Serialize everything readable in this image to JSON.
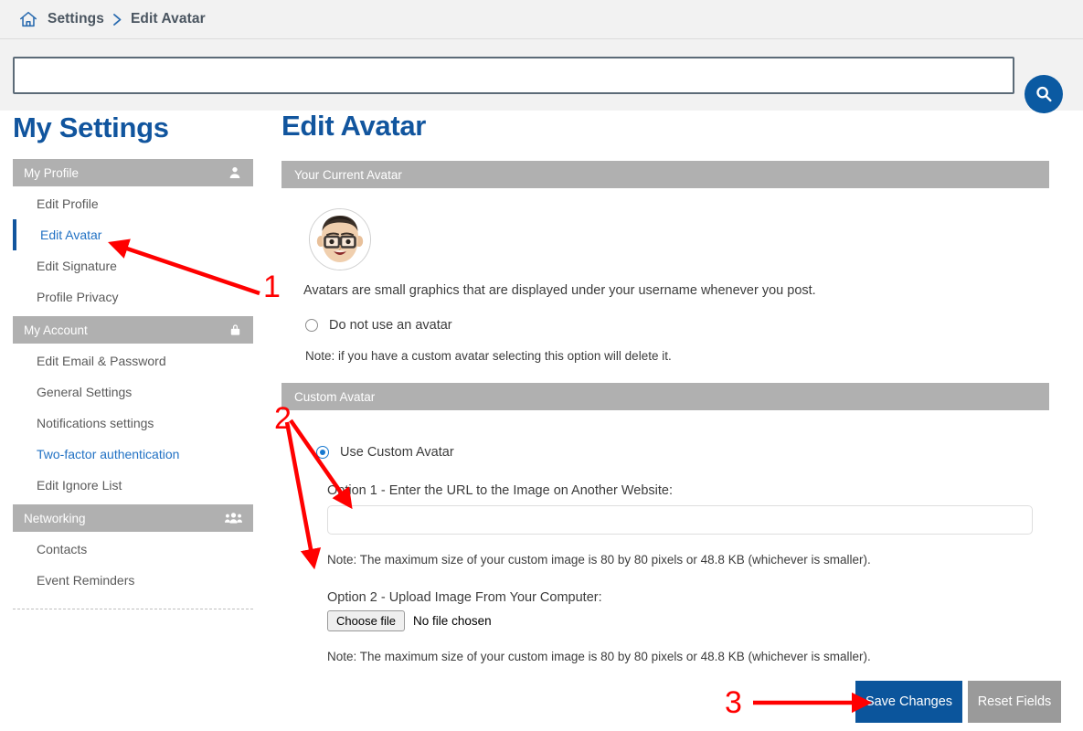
{
  "breadcrumb": {
    "home_icon": "home-icon",
    "items": [
      "Settings",
      "Edit Avatar"
    ],
    "separator": "›"
  },
  "search": {
    "value": "",
    "placeholder": "",
    "button_icon": "search-icon"
  },
  "sidebar": {
    "title": "My Settings",
    "groups": [
      {
        "header": "My Profile",
        "icon": "user-icon",
        "items": [
          {
            "label": "Edit Profile",
            "state": "normal"
          },
          {
            "label": "Edit Avatar",
            "state": "active"
          },
          {
            "label": "Edit Signature",
            "state": "normal"
          },
          {
            "label": "Profile Privacy",
            "state": "normal"
          }
        ]
      },
      {
        "header": "My Account",
        "icon": "lock-icon",
        "items": [
          {
            "label": "Edit Email & Password",
            "state": "normal"
          },
          {
            "label": "General Settings",
            "state": "normal"
          },
          {
            "label": "Notifications settings",
            "state": "normal"
          },
          {
            "label": "Two-factor authentication",
            "state": "link"
          },
          {
            "label": "Edit Ignore List",
            "state": "normal"
          }
        ]
      },
      {
        "header": "Networking",
        "icon": "people-icon",
        "items": [
          {
            "label": "Contacts",
            "state": "normal"
          },
          {
            "label": "Event Reminders",
            "state": "normal"
          }
        ]
      }
    ]
  },
  "main": {
    "title": "Edit Avatar",
    "current_avatar": {
      "header": "Your Current Avatar",
      "avatar_alt": "avatar-image",
      "description": "Avatars are small graphics that are displayed under your username whenever you post.",
      "no_avatar_label": "Do not use an avatar",
      "no_avatar_selected": false,
      "note": "Note: if you have a custom avatar selecting this option will delete it."
    },
    "custom_avatar": {
      "header": "Custom Avatar",
      "use_custom_label": "Use Custom Avatar",
      "use_custom_selected": true,
      "option1_label": "Option 1 - Enter the URL to the Image on Another Website:",
      "option1_value": "",
      "option1_placeholder": "",
      "option1_note": "Note: The maximum size of your custom image is 80 by 80 pixels or 48.8 KB (whichever is smaller).",
      "option2_label": "Option 2 - Upload Image From Your Computer:",
      "choose_file_label": "Choose file",
      "file_status": "No file chosen",
      "option2_note": "Note: The maximum size of your custom image is 80 by 80 pixels or 48.8 KB (whichever is smaller)."
    }
  },
  "footer": {
    "save_label": "Save Changes",
    "reset_label": "Reset Fields"
  },
  "annotations": {
    "marker_1": "1",
    "marker_2": "2",
    "marker_3": "3",
    "color": "#ff0000"
  },
  "colors": {
    "brand_blue": "#11559e",
    "link_blue": "#2272c4",
    "header_gray": "#b0b0b0",
    "button_primary": "#0b559c",
    "button_secondary": "#9a9a9a",
    "annotation_red": "#ff0000"
  }
}
